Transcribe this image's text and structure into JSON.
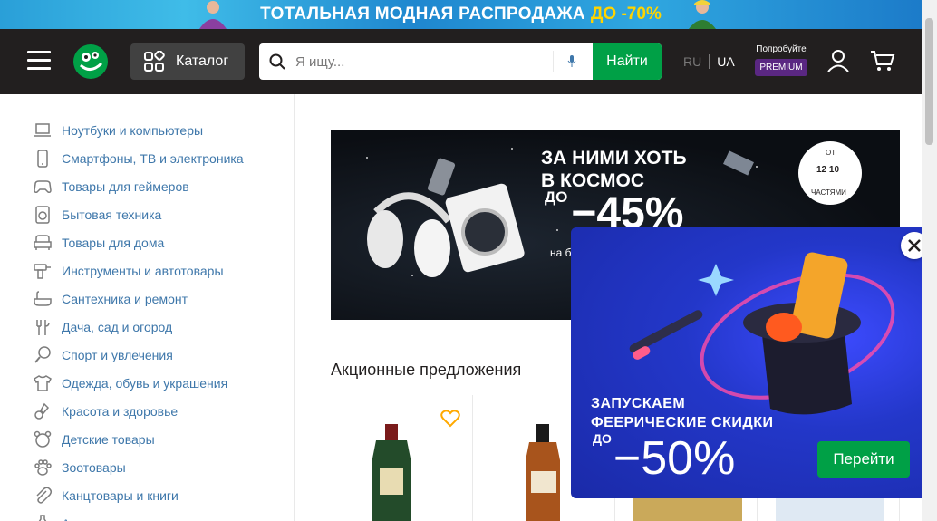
{
  "promo": {
    "text": "ТОТАЛЬНАЯ МОДНАЯ РАСПРОДАЖА",
    "accent": "ДО -70%"
  },
  "header": {
    "catalog_label": "Каталог",
    "search_placeholder": "Я ищу...",
    "find_label": "Найти",
    "lang_ru": "RU",
    "lang_ua": "UA",
    "premium_try": "Попробуйте",
    "premium_badge": "PREMIUM"
  },
  "sidebar": {
    "items": [
      {
        "label": "Ноутбуки и компьютеры",
        "icon": "laptop-icon"
      },
      {
        "label": "Смартфоны, ТВ и электроника",
        "icon": "smartphone-icon"
      },
      {
        "label": "Товары для геймеров",
        "icon": "gamepad-icon"
      },
      {
        "label": "Бытовая техника",
        "icon": "washing-machine-icon"
      },
      {
        "label": "Товары для дома",
        "icon": "armchair-icon"
      },
      {
        "label": "Инструменты и автотовары",
        "icon": "drill-icon"
      },
      {
        "label": "Сантехника и ремонт",
        "icon": "bathtub-icon"
      },
      {
        "label": "Дача, сад и огород",
        "icon": "garden-fork-icon"
      },
      {
        "label": "Спорт и увлечения",
        "icon": "racket-icon"
      },
      {
        "label": "Одежда, обувь и украшения",
        "icon": "tshirt-icon"
      },
      {
        "label": "Красота и здоровье",
        "icon": "beauty-icon"
      },
      {
        "label": "Детские товары",
        "icon": "bear-icon"
      },
      {
        "label": "Зоотовары",
        "icon": "paw-icon"
      },
      {
        "label": "Канцтовары и книги",
        "icon": "paperclip-icon"
      },
      {
        "label": "Алкогольные напитки и продукты",
        "icon": "bottle-icon"
      }
    ]
  },
  "hero": {
    "title_line1": "ЗА НИМИ ХОТЬ",
    "title_line2": "В КОСМОС",
    "pre": "ДО",
    "discount": "−45%",
    "small": "на б",
    "parts_from": "ОТ",
    "parts_numbers": "12 10",
    "parts_label": "ЧАСТЯМИ"
  },
  "main": {
    "section_title": "Акционные предложения"
  },
  "popup": {
    "line1": "ЗАПУСКАЕМ",
    "line2": "ФЕЕРИЧЕСКИЕ СКИДКИ",
    "pre": "ДО",
    "discount": "−50%",
    "go_label": "Перейти"
  },
  "colors": {
    "header_bg": "#221f1f",
    "green": "#00a046",
    "link": "#3e77aa",
    "premium": "#5a2782",
    "popup_bg": "#2337c9"
  }
}
